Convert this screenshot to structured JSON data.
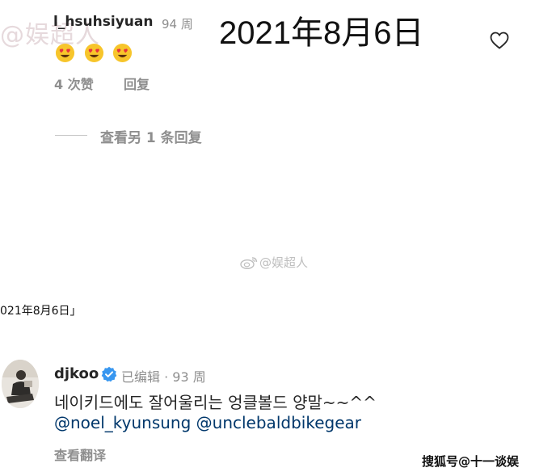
{
  "watermark_top": {
    "at": "@",
    "text": "娱超人"
  },
  "comment1": {
    "username": "l_hsuhsiyuan",
    "time": "94 周",
    "reactions": [
      "😍",
      "😍",
      "😍"
    ],
    "likes": "4 次赞",
    "reply_label": "回复",
    "more_replies": "查看另 1 条回复"
  },
  "date_overlay": "2021年8月6日",
  "watermark_center": {
    "text": "@娱超人",
    "icon": "weibo-icon"
  },
  "date_small": "021年8月6日」",
  "comment2": {
    "username": "djkoo",
    "edited": "已编辑",
    "dot": "·",
    "time": "93 周",
    "text": "네이키드에도 잘어울리는 엉클볼드 양말~~^^",
    "mention1": "@noel_kyunsung",
    "mention2": "@unclebaldbikegear",
    "translate": "查看翻译"
  },
  "watermark_bottom": "搜狐号@十一谈娱",
  "colors": {
    "secondary_text": "#8e8e8e",
    "mention": "#00376b",
    "verified": "#3897f0"
  }
}
